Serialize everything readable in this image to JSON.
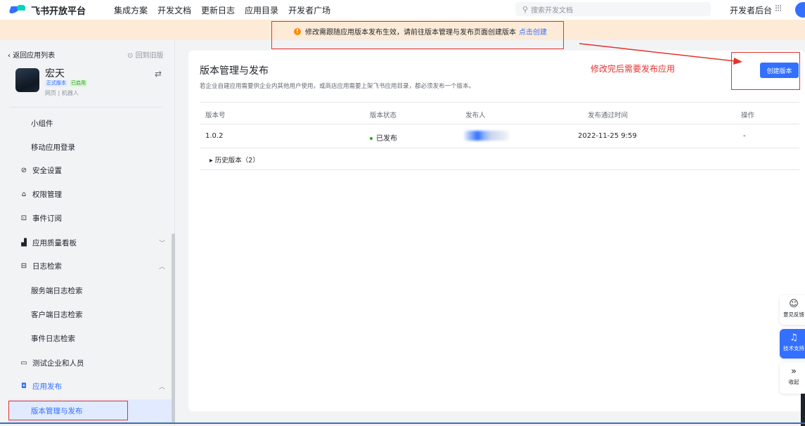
{
  "topnav": {
    "brand": "飞书开放平台",
    "links": [
      "集成方案",
      "开发文档",
      "更新日志",
      "应用目录",
      "开发者广场"
    ],
    "search_placeholder": "搜索开发文档",
    "dev_console": "开发者后台"
  },
  "notice": {
    "text": "修改需跟随应用版本发布生效，请前往版本管理与发布页面创建版本",
    "link": "点击创建"
  },
  "sidebar": {
    "back": "返回应用列表",
    "restore": "回到旧版",
    "app_name": "宏天",
    "badge_version": "正式版本",
    "badge_status": "已启用",
    "app_tags": "网页 | 机器人",
    "items": [
      {
        "label": "小组件",
        "type": "sub"
      },
      {
        "label": "移动应用登录",
        "type": "sub"
      },
      {
        "label": "安全设置",
        "icon": "shield-icon"
      },
      {
        "label": "权限管理",
        "icon": "lock-icon"
      },
      {
        "label": "事件订阅",
        "icon": "event-icon"
      },
      {
        "label": "应用质量看板",
        "icon": "chart-icon"
      },
      {
        "label": "日志检索",
        "icon": "search-log-icon"
      },
      {
        "label": "服务端日志检索",
        "type": "sub"
      },
      {
        "label": "客户端日志检索",
        "type": "sub"
      },
      {
        "label": "事件日志检索",
        "type": "sub"
      },
      {
        "label": "测试企业和人员",
        "icon": "test-icon"
      },
      {
        "label": "应用发布",
        "icon": "publish-icon"
      },
      {
        "label": "版本管理与发布",
        "type": "active"
      }
    ]
  },
  "main": {
    "title": "版本管理与发布",
    "description": "若企业自建应用需要供企业内其他用户使用，或商店应用需要上架飞书应用目录，都必须发布一个版本。",
    "annotation": "修改完后需要发布应用",
    "create_button": "创建版本",
    "table": {
      "headers": [
        "版本号",
        "版本状态",
        "发布人",
        "发布通过时间",
        "操作"
      ],
      "rows": [
        {
          "version": "1.0.2",
          "status": "已发布",
          "time": "2022-11-25 9:59",
          "action": "-"
        }
      ]
    },
    "history": "历史版本（2）"
  },
  "float": {
    "feedback": "意见反馈",
    "support": "技术支持",
    "collapse": "收起"
  },
  "colors": {
    "accent": "#3370ff",
    "annotation": "#e5322d",
    "notice_bg": "#fdebd8"
  }
}
